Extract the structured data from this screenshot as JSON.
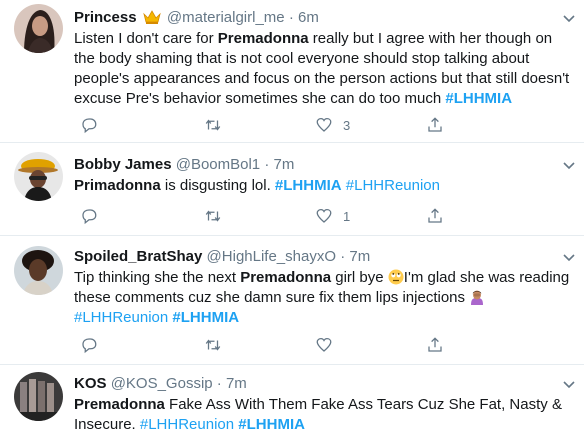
{
  "tweets": [
    {
      "name": "Princess",
      "handle": "@materialgirl_me",
      "dot": "·",
      "time": "6m",
      "body": [
        {
          "t": "Listen I don't care for "
        },
        {
          "t": "Premadonna",
          "b": true
        },
        {
          "t": " really but I agree with her though on the  body shaming that is not cool everyone should stop talking about people's appearances and focus on the person actions but that still doesn't excuse Pre's behavior sometimes she can do too much "
        },
        {
          "t": "#LHHMIA",
          "tag": true,
          "b": true
        }
      ],
      "likes": "3"
    },
    {
      "name": "Bobby James",
      "handle": "@BoomBol1",
      "dot": "·",
      "time": "7m",
      "body": [
        {
          "t": "Primadonna",
          "b": true
        },
        {
          "t": " is disgusting lol. "
        },
        {
          "t": "#LHHMIA",
          "tag": true,
          "b": true
        },
        {
          "t": " "
        },
        {
          "t": "#LHHReunion",
          "tag": true
        }
      ],
      "likes": "1"
    },
    {
      "name": "Spoiled_BratShay",
      "handle": "@HighLife_shayxO",
      "dot": "·",
      "time": "7m",
      "body": [
        {
          "t": "Tip thinking she the next "
        },
        {
          "t": "Premadonna",
          "b": true
        },
        {
          "t": " girl bye "
        },
        {
          "emoji": "face-with-rolling-eyes"
        },
        {
          "t": "I'm glad she was reading these comments cuz she damn sure fix them lips injections "
        },
        {
          "emoji": "woman-facepalming"
        },
        {
          "br": true
        },
        {
          "t": "#LHHReunion",
          "tag": true
        },
        {
          "t": " "
        },
        {
          "t": "#LHHMIA",
          "tag": true,
          "b": true
        }
      ],
      "likes": ""
    },
    {
      "name": "KOS",
      "handle": "@KOS_Gossip",
      "dot": "·",
      "time": "7m",
      "body": [
        {
          "t": "Premadonna",
          "b": true
        },
        {
          "t": " Fake Ass With Them Fake Ass Tears Cuz She Fat, Nasty & Insecure. "
        },
        {
          "t": "#LHHReunion",
          "tag": true
        },
        {
          "t": " "
        },
        {
          "t": "#LHHMIA",
          "tag": true,
          "b": true
        }
      ],
      "likes": ""
    }
  ],
  "colors": {
    "link": "#1da1f2",
    "muted": "#657786",
    "text": "#14171a",
    "divider": "#e6ecf0"
  },
  "icons": [
    "reply-icon",
    "retweet-icon",
    "like-icon",
    "share-icon",
    "caret-down-icon",
    "crown-icon"
  ]
}
